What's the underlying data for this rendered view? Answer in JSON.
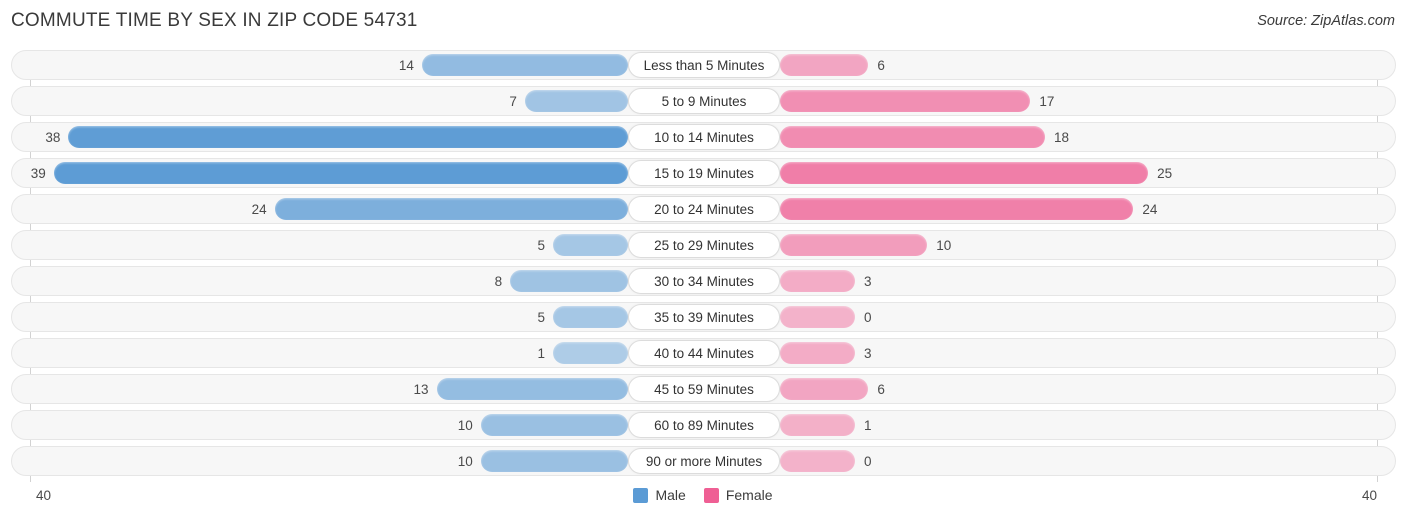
{
  "header": {
    "title": "COMMUTE TIME BY SEX IN ZIP CODE 54731",
    "source": "Source: ZipAtlas.com"
  },
  "legend": {
    "male_label": "Male",
    "female_label": "Female",
    "male_color": "#5b9bd5",
    "female_color": "#ef5f94"
  },
  "axis": {
    "left_tick": "40",
    "right_tick": "40",
    "max": 40
  },
  "chart_data": {
    "type": "bar",
    "title": "COMMUTE TIME BY SEX IN ZIP CODE 54731",
    "subtitle": "Source: ZipAtlas.com",
    "orientation": "horizontal-diverging",
    "xlabel": "",
    "ylabel": "",
    "xlim": [
      40,
      40
    ],
    "grid": false,
    "legend_position": "bottom-center",
    "categories": [
      "Less than 5 Minutes",
      "5 to 9 Minutes",
      "10 to 14 Minutes",
      "15 to 19 Minutes",
      "20 to 24 Minutes",
      "25 to 29 Minutes",
      "30 to 34 Minutes",
      "35 to 39 Minutes",
      "40 to 44 Minutes",
      "45 to 59 Minutes",
      "60 to 89 Minutes",
      "90 or more Minutes"
    ],
    "series": [
      {
        "name": "Male",
        "color": "#5b9bd5",
        "side": "left",
        "values": [
          14,
          7,
          38,
          39,
          24,
          5,
          8,
          5,
          1,
          13,
          10,
          10
        ]
      },
      {
        "name": "Female",
        "color": "#ef5f94",
        "side": "right",
        "values": [
          6,
          17,
          18,
          25,
          24,
          10,
          3,
          0,
          3,
          6,
          1,
          0
        ]
      }
    ]
  }
}
